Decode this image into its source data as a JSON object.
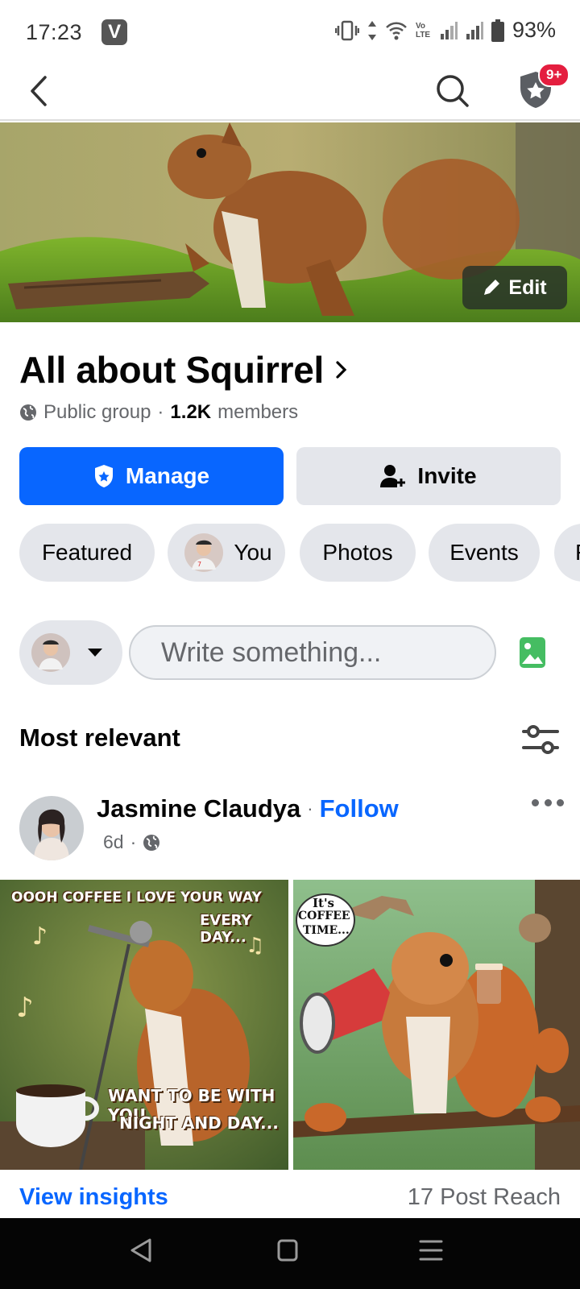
{
  "status_bar": {
    "time": "17:23",
    "app_badge": "V",
    "network_label": "Vo LTE",
    "battery": "93%"
  },
  "top_nav": {
    "notification_count": "9+"
  },
  "cover": {
    "edit_label": "Edit"
  },
  "group": {
    "name": "All about Squirrel",
    "chevron": "›",
    "privacy": "Public group",
    "separator": "·",
    "members_count": "1.2K",
    "members_label": "members"
  },
  "actions": {
    "manage_label": "Manage",
    "invite_label": "Invite"
  },
  "tabs": [
    {
      "label": "Featured"
    },
    {
      "label": "You"
    },
    {
      "label": "Photos"
    },
    {
      "label": "Events"
    },
    {
      "label": "F"
    }
  ],
  "composer": {
    "placeholder": "Write something..."
  },
  "feed": {
    "sort_label": "Most relevant"
  },
  "post": {
    "author": "Jasmine Claudya",
    "separator": "·",
    "follow_label": "Follow",
    "age": "6d",
    "image_left_caption_top": "OOOH COFFEE I LOVE YOUR WAY",
    "image_left_caption_top2": "EVERY DAY...",
    "image_left_caption_bottom": "WANT TO BE WITH YOU",
    "image_left_caption_bottom2": "NIGHT AND DAY...",
    "image_right_bubble_1": "It's",
    "image_right_bubble_2": "COFFEE",
    "image_right_bubble_3": "TIME...",
    "insights_label": "View insights",
    "reach_label": "17 Post Reach"
  },
  "colors": {
    "primary": "#0866ff",
    "chip_bg": "#e4e6eb",
    "secondary_text": "#65676b",
    "notification_red": "#e41e3f",
    "photo_green": "#45bd62"
  }
}
